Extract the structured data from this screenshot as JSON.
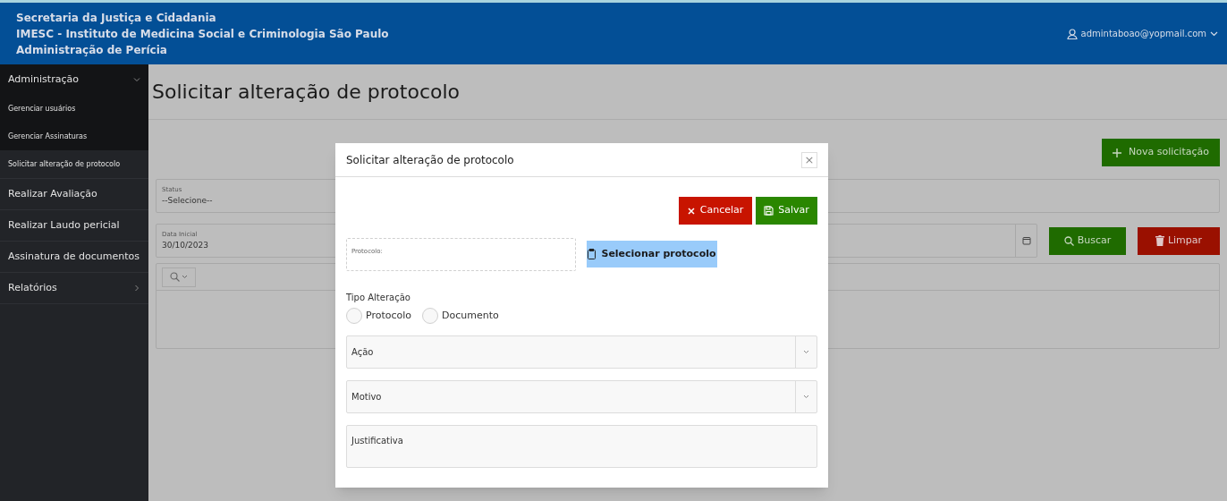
{
  "header": {
    "lines": [
      "Secretaria da Justiça e Cidadania",
      "IMESC - Instituto de Medicina Social e Criminologia São Paulo",
      "Administração de Perícia"
    ],
    "user": "admintaboao@yopmail.com"
  },
  "sidebar": {
    "items": [
      {
        "kind": "group",
        "label": "Administração",
        "expanded": true,
        "children": [
          {
            "label": "Gerenciar usuários",
            "selected": false
          },
          {
            "label": "Gerenciar Assinaturas",
            "selected": false
          },
          {
            "label": "Solicitar alteração de protocolo",
            "selected": true
          }
        ]
      },
      {
        "kind": "link",
        "label": "Realizar Avaliação",
        "selected": false
      },
      {
        "kind": "link",
        "label": "Realizar Laudo pericial",
        "selected": false
      },
      {
        "kind": "link",
        "label": "Assinatura de documentos",
        "selected": false
      },
      {
        "kind": "group",
        "label": "Relatórios",
        "expanded": false
      }
    ]
  },
  "page": {
    "title": "Solicitar alteração de protocolo",
    "new_button": "Nova solicitação",
    "status": {
      "label": "Status",
      "value": "--Selecione--"
    },
    "date": {
      "label": "Data Inicial",
      "value": "30/10/2023"
    },
    "search_button": "Buscar",
    "clear_button": "Limpar"
  },
  "modal": {
    "title": "Solicitar alteração de protocolo",
    "close": "×",
    "cancel_button": "Cancelar",
    "save_button": "Salvar",
    "protocol_label": "Protocolo:",
    "select_protocol_button": "Selecionar protocolo",
    "type_label": "Tipo Alteração",
    "type_options": [
      {
        "label": "Protocolo",
        "selected": false
      },
      {
        "label": "Documento",
        "selected": false
      }
    ],
    "selects": [
      {
        "placeholder": "Ação"
      },
      {
        "placeholder": "Motivo"
      }
    ],
    "justification_placeholder": "Justificativa"
  }
}
